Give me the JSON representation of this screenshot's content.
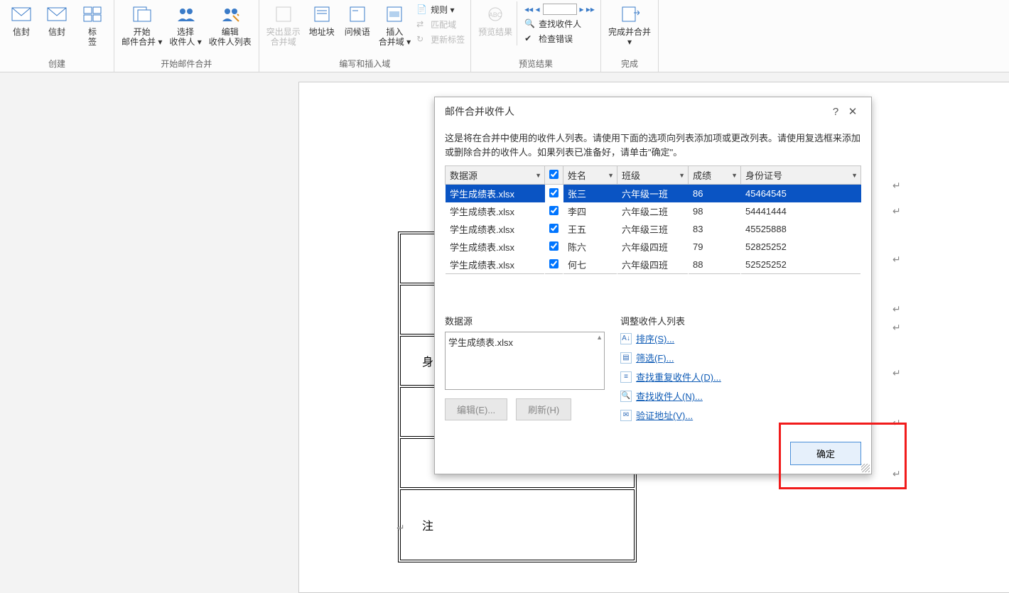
{
  "ribbon": {
    "groups": {
      "create": {
        "label": "创建",
        "btn1": "信封",
        "btn2": "信封",
        "btn3": "标\n签"
      },
      "start": {
        "label": "开始邮件合并",
        "btn1": "开始\n邮件合并 ▾",
        "btn2": "选择\n收件人 ▾",
        "btn3": "编辑\n收件人列表"
      },
      "write": {
        "label": "编写和插入域",
        "btn1": "突出显示\n合并域",
        "btn2": "地址块",
        "btn3": "问候语",
        "btn4": "插入\n合并域 ▾",
        "small1": "规则 ▾",
        "small2": "匹配域",
        "small3": "更新标签"
      },
      "preview": {
        "label": "预览结果",
        "btn1": "预览结果",
        "small1": "查找收件人",
        "small2": "检查错误"
      },
      "finish": {
        "label": "完成",
        "btn1": "完成并合并\n▾"
      }
    }
  },
  "doc": {
    "cell3": "身",
    "cell6": "注"
  },
  "dialog": {
    "title": "邮件合并收件人",
    "msg": "这是将在合并中使用的收件人列表。请使用下面的选项向列表添加项或更改列表。请使用复选框来添加或删除合并的收件人。如果列表已准备好，请单击\"确定\"。",
    "cols": {
      "source": "数据源",
      "name": "姓名",
      "class": "班级",
      "score": "成绩",
      "id": "身份证号"
    },
    "rows": [
      {
        "source": "学生成绩表.xlsx",
        "name": "张三",
        "class": "六年级一班",
        "score": "86",
        "id": "45464545",
        "selected": true
      },
      {
        "source": "学生成绩表.xlsx",
        "name": "李四",
        "class": "六年级二班",
        "score": "98",
        "id": "54441444"
      },
      {
        "source": "学生成绩表.xlsx",
        "name": "王五",
        "class": "六年级三班",
        "score": "83",
        "id": "45525888"
      },
      {
        "source": "学生成绩表.xlsx",
        "name": "陈六",
        "class": "六年级四班",
        "score": "79",
        "id": "52825252"
      },
      {
        "source": "学生成绩表.xlsx",
        "name": "何七",
        "class": "六年级四班",
        "score": "88",
        "id": "52525252"
      }
    ],
    "ds_label": "数据源",
    "ds_item": "学生成绩表.xlsx",
    "edit_btn": "编辑(E)...",
    "refresh_btn": "刷新(H)",
    "refine_label": "调整收件人列表",
    "links": {
      "sort": "排序(S)...",
      "filter": "筛选(F)...",
      "dupes": "查找重复收件人(D)...",
      "find": "查找收件人(N)...",
      "validate": "验证地址(V)..."
    },
    "ok": "确定"
  }
}
